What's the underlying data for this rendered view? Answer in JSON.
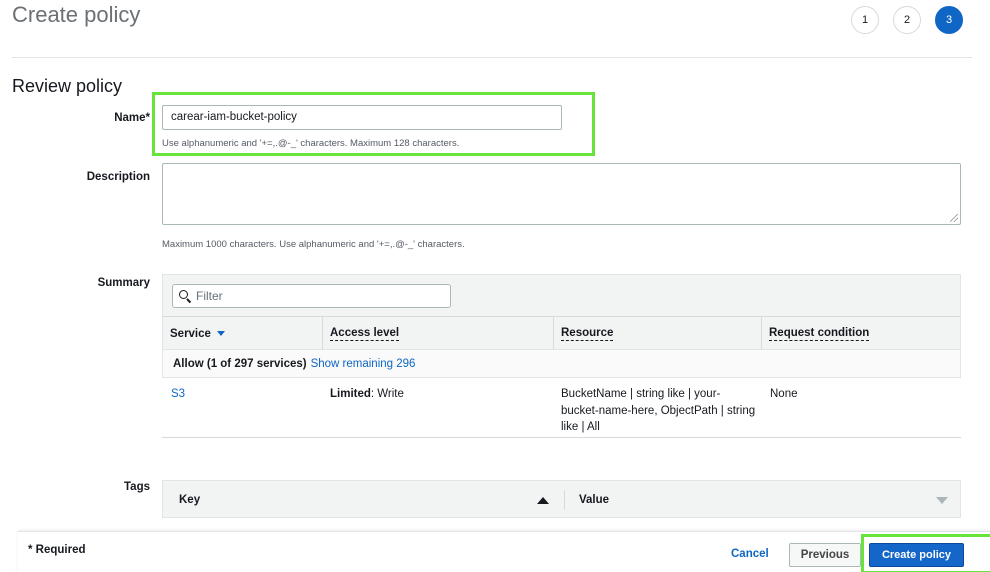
{
  "page": {
    "title": "Create policy",
    "steps": [
      "1",
      "2",
      "3"
    ],
    "active_step": "3",
    "section_title": "Review policy"
  },
  "form": {
    "name_label": "Name*",
    "name_value": "carear-iam-bucket-policy",
    "name_help": "Use alphanumeric and '+=,.@-_' characters. Maximum 128 characters.",
    "description_label": "Description",
    "description_value": "",
    "description_help": "Maximum 1000 characters. Use alphanumeric and '+=,.@-_' characters.",
    "summary_label": "Summary",
    "tags_label": "Tags"
  },
  "summary": {
    "filter_placeholder": "Filter",
    "columns": [
      "Service",
      "Access level",
      "Resource",
      "Request condition"
    ],
    "allow_text": "Allow (1 of 297 services)",
    "show_remaining": "Show remaining 296",
    "rows": [
      {
        "service": "S3",
        "access_strong": "Limited",
        "access_rest": ": Write",
        "resource": "BucketName | string like | your-bucket-name-here, ObjectPath | string like | All",
        "condition": "None"
      }
    ]
  },
  "tags": {
    "columns": [
      "Key",
      "Value"
    ]
  },
  "footer": {
    "required": "* Required",
    "cancel": "Cancel",
    "previous": "Previous",
    "create": "Create policy"
  },
  "colors": {
    "accent": "#0f66c5",
    "highlight": "#66e43a",
    "primary_button": "#1466c8"
  }
}
